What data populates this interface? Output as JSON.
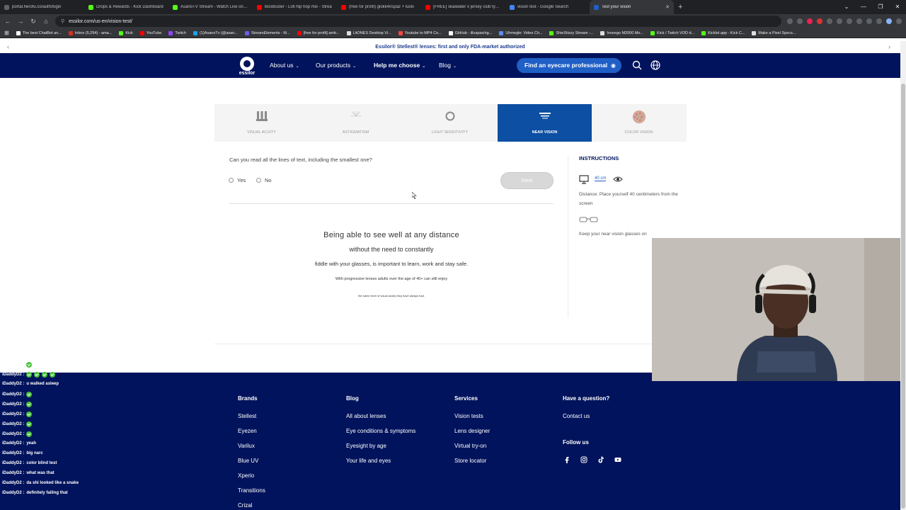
{
  "browser": {
    "tabs": [
      {
        "label": "portal.herofu.co/auth/login",
        "color": "#5f6368"
      },
      {
        "label": "Drops & Rewards - Kick Dashboard",
        "color": "#53fc18"
      },
      {
        "label": "AsanoTV Stream - Watch Live on Kick",
        "color": "#53fc18"
      },
      {
        "label": "BoxBuster - Lofi hip hop mix - Strea",
        "color": "#ff0000"
      },
      {
        "label": "(free for profit) glokk40spaz + lucki",
        "color": "#ff0000"
      },
      {
        "label": "[FREE] skaiwater x jersey club type be",
        "color": "#ff0000"
      },
      {
        "label": "vision test - Google Search",
        "color": "#4285f4"
      },
      {
        "label": "Test your vision",
        "color": "#1f5fc6"
      }
    ],
    "new_tab": "+",
    "url": "essilor.com/us-en/vision-test/",
    "bookmarks": [
      "The best ChatBot an...",
      "Inbox (5,294) - ama...",
      "Kick",
      "YouTube",
      "Twitch",
      "(1)AsanoTv (@asan...",
      "StreamElements - M...",
      "[free for profit] amb...",
      "LitONES Desktop Vi...",
      "Youtube to MP4 Co...",
      "GitHub - illuspas/ng...",
      "Uhmegle: Video Ch...",
      "ShieStizzy Stream -...",
      "Inseego M2000 Mo...",
      "Kick / Twitch VOD d...",
      "Kicklet.app - Kick C...",
      "Make a Pixel Specs..."
    ]
  },
  "announcement": "Essilor® Stellest® lenses: first and only FDA-market authorized",
  "nav": {
    "logo_text": "essilor",
    "items": [
      {
        "label": "About us",
        "bold": false
      },
      {
        "label": "Our products",
        "bold": false
      },
      {
        "label": "Help me choose",
        "bold": true
      },
      {
        "label": "Blog",
        "bold": false
      }
    ],
    "find_button": "Find an eyecare professional"
  },
  "test_tabs": [
    {
      "label": "VISUAL ACUITY",
      "active": false
    },
    {
      "label": "ASTIGMATISM",
      "active": false
    },
    {
      "label": "LIGHT SENSITIVITY",
      "active": false
    },
    {
      "label": "NEAR VISION",
      "active": true
    },
    {
      "label": "COLOR VISION",
      "active": false
    }
  ],
  "question": {
    "text": "Can you read all the lines of text, including the smallest one?",
    "options": [
      "Yes",
      "No"
    ],
    "next_label": "Next"
  },
  "reading_lines": [
    "Being able to see well at any distance",
    "without the need to constantly",
    "fiddle with your glasses, is important to learn, work and stay safe.",
    "With progressive lenses adults over the age of 40+ can still enjoy",
    "the same level of visual acuity they have always had."
  ],
  "instructions": {
    "title": "INSTRUCTIONS",
    "distance": "40 cm",
    "step1": "Distance: Place yourself 40 centimeters from the screen",
    "step2": "Keep your near vision glasses on"
  },
  "footer": {
    "columns": [
      {
        "title": "Brands",
        "links": [
          "Stellest",
          "Eyezen",
          "Varilux",
          "Blue UV",
          "Xperio",
          "Transitions",
          "Crizal"
        ]
      },
      {
        "title": "Blog",
        "links": [
          "All about lenses",
          "Eye conditions & symptoms",
          "Eyesight by age",
          "Your life and eyes"
        ]
      },
      {
        "title": "Services",
        "links": [
          "Vision tests",
          "Lens designer",
          "Virtual try-on",
          "Store locator"
        ]
      },
      {
        "title": "Have a question?",
        "links": [
          "Contact us"
        ]
      }
    ],
    "follow_title": "Follow us",
    "social_icons": [
      "facebook-icon",
      "instagram-icon",
      "tiktok-icon",
      "youtube-icon"
    ]
  },
  "chat": [
    {
      "user": "iDaddyD2 :",
      "msg": "",
      "emote": true
    },
    {
      "user": "iDaddyD2 :",
      "msg": "",
      "emote": true,
      "multi": 4
    },
    {
      "user": "iDaddyD2 :",
      "msg": "u walked asleep",
      "emote": false
    },
    {
      "user": "iDaddyD2 :",
      "msg": "",
      "emote": true
    },
    {
      "user": "iDaddyD2 :",
      "msg": "",
      "emote": true
    },
    {
      "user": "iDaddyD2 :",
      "msg": "",
      "emote": true
    },
    {
      "user": "iDaddyD2 :",
      "msg": "",
      "emote": true
    },
    {
      "user": "iDaddyD2 :",
      "msg": "",
      "emote": true
    },
    {
      "user": "iDaddyD2 :",
      "msg": "yeah",
      "emote": false
    },
    {
      "user": "iDaddyD2 :",
      "msg": "big narc",
      "emote": false
    },
    {
      "user": "iDaddyD2 :",
      "msg": "color blind test",
      "emote": false
    },
    {
      "user": "iDaddyD2 :",
      "msg": "what was that",
      "emote": false
    },
    {
      "user": "iDaddyD2 :",
      "msg": "da shi looked like a snake",
      "emote": false
    },
    {
      "user": "iDaddyD2 :",
      "msg": "definitely failing that",
      "emote": false
    }
  ],
  "colors": {
    "nav_bg": "#01135c",
    "accent": "#1f5fc6",
    "active_tab": "#0c4fa3",
    "chat_emote": "#49c33a"
  }
}
